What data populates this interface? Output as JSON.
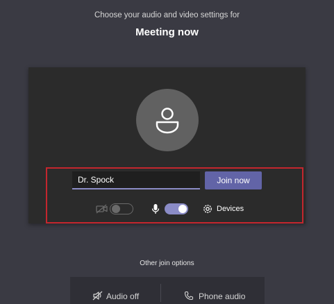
{
  "header": {
    "subtitle": "Choose your audio and video settings for",
    "title": "Meeting now"
  },
  "join": {
    "name_value": "Dr. Spock",
    "join_label": "Join now"
  },
  "controls": {
    "camera_on": false,
    "mic_on": true,
    "devices_label": "Devices"
  },
  "other": {
    "label": "Other join options",
    "audio_off_label": "Audio off",
    "phone_audio_label": "Phone audio"
  },
  "colors": {
    "background": "#3a3a43",
    "accent": "#6264a7",
    "toggle_on": "#8b8cc7",
    "highlight_border": "#c4262e"
  },
  "icons": {
    "avatar": "person-icon",
    "camera": "camera-off-icon",
    "mic": "microphone-icon",
    "devices": "gear-icon",
    "audio_off": "speaker-off-icon",
    "phone": "phone-icon"
  }
}
